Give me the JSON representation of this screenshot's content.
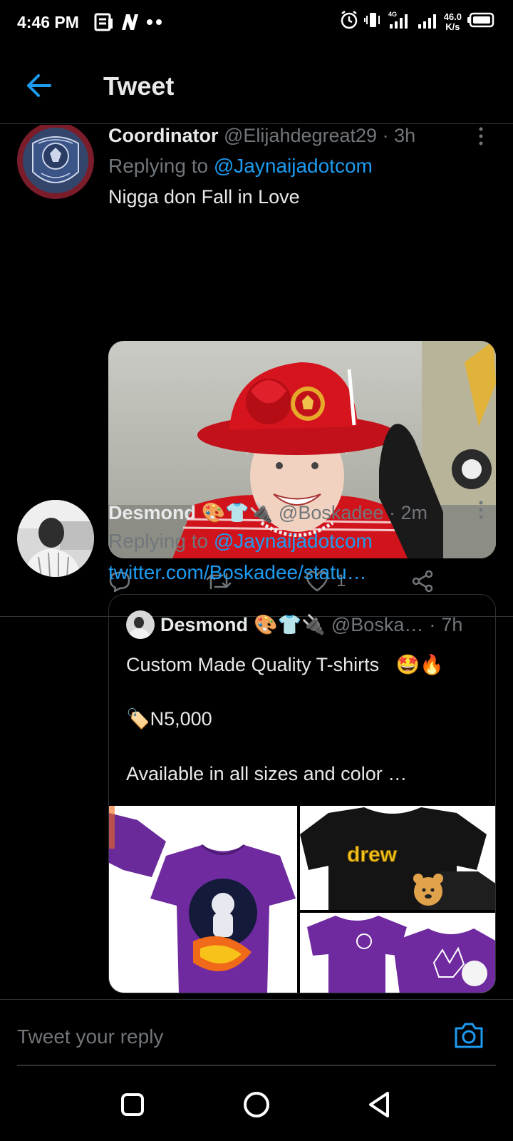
{
  "status_bar": {
    "time": "4:46 PM",
    "net_speed_value": "46.0",
    "net_speed_unit": "K/s",
    "network_type": "4G",
    "icons": [
      "notes-icon",
      "n-app-icon",
      "dots-icon",
      "alarm-icon",
      "vibrate-icon",
      "signal-icon",
      "signal-icon-2",
      "battery-icon"
    ]
  },
  "header": {
    "title": "Tweet",
    "back_icon": "arrow-left-icon"
  },
  "tweets": [
    {
      "name": "Coordinator",
      "handle": "@Elijahdegreat29",
      "dot": "·",
      "time": "3h",
      "replying_prefix": "Replying to",
      "replying_to": "@Jaynaijadotcom",
      "text": "Nigga don Fall in Love",
      "media_alt": "Queen in red Manchester United hat waving",
      "reply_count": "",
      "retweet_count": "",
      "like_count": "1"
    },
    {
      "name": "Desmond",
      "name_emoji": "🎨👕🔌",
      "handle": "@Boskadee",
      "dot": "·",
      "time": "2m",
      "replying_prefix": "Replying to",
      "replying_to": "@Jaynaijadotcom",
      "link": "twitter.com/Boskadee/statu…",
      "quote": {
        "name": "Desmond",
        "name_emoji": "🎨👕🔌",
        "handle": "@Boska…",
        "dot": "·",
        "time": "7h",
        "line1": "Custom Made Quality T-shirts",
        "line1_emoji": "🤩🔥",
        "line2_emoji": "🏷️",
        "line2": "N5,000",
        "line3": "Available in all sizes and color …",
        "shirt_text": "drew"
      }
    }
  ],
  "reply_bar": {
    "placeholder": "Tweet your reply"
  },
  "colors": {
    "background": "#000000",
    "accent": "#1d9bf0",
    "muted": "#71767b",
    "divider": "#2f3336",
    "text": "#e7e9ea"
  }
}
